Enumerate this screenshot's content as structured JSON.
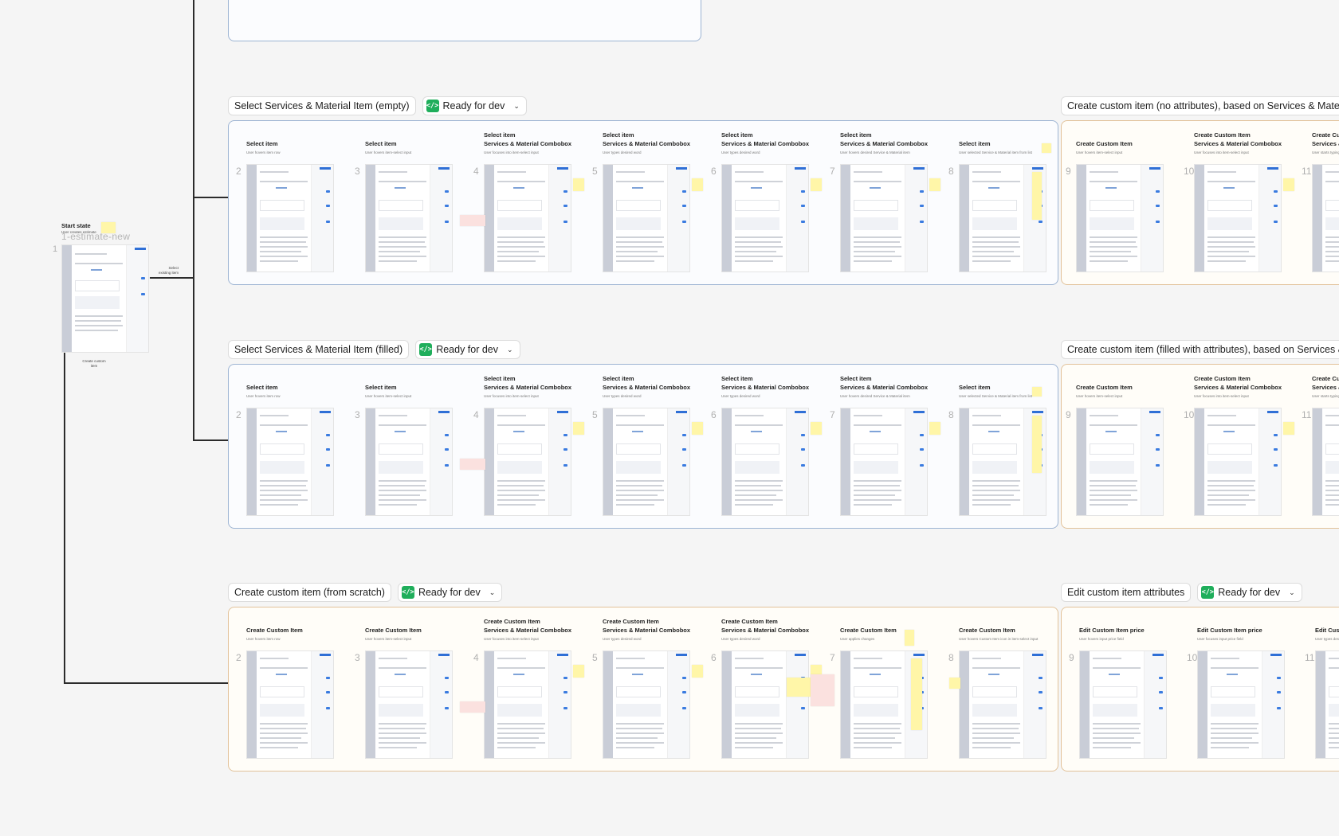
{
  "start_state": {
    "title": "Start state",
    "subtitle": "User creates estimate",
    "page_name": "1-estimate-new",
    "number": "1",
    "edge_select_label": "Select existing item",
    "edge_create_label": "Create custom item"
  },
  "status_label": "Ready for dev",
  "status_icon": "</>",
  "status_color": "#1fae5b",
  "sections": [
    {
      "title": "Select Services & Material Item (empty)",
      "status": "Ready for dev",
      "frames": [
        {
          "num": "2",
          "h1": "",
          "h2": "Select item",
          "sub": "User hovers item row"
        },
        {
          "num": "3",
          "h1": "",
          "h2": "Select item",
          "sub": "User hovers item-select input"
        },
        {
          "num": "4",
          "h1": "Select item",
          "h2": "Services & Material Combobox",
          "sub": "User focuses into item-select input"
        },
        {
          "num": "5",
          "h1": "Select item",
          "h2": "Services & Material Combobox",
          "sub": "User types desired word"
        },
        {
          "num": "6",
          "h1": "Select item",
          "h2": "Services & Material Combobox",
          "sub": "User types desired word"
        },
        {
          "num": "7",
          "h1": "Select item",
          "h2": "Services & Material Combobox",
          "sub": "User hovers desired Service & Material item"
        },
        {
          "num": "8",
          "h1": "",
          "h2": "Select item",
          "sub": "User selected Service & Material item from list"
        }
      ]
    },
    {
      "title": "Select Services & Material Item (filled)",
      "status": "Ready for dev",
      "frames": [
        {
          "num": "2",
          "h1": "",
          "h2": "Select item",
          "sub": "User hovers item row"
        },
        {
          "num": "3",
          "h1": "",
          "h2": "Select item",
          "sub": "User hovers item-select input"
        },
        {
          "num": "4",
          "h1": "Select item",
          "h2": "Services & Material Combobox",
          "sub": "User focuses into item-select input"
        },
        {
          "num": "5",
          "h1": "Select item",
          "h2": "Services & Material Combobox",
          "sub": "User types desired word"
        },
        {
          "num": "6",
          "h1": "Select item",
          "h2": "Services & Material Combobox",
          "sub": "User types desired word"
        },
        {
          "num": "7",
          "h1": "Select item",
          "h2": "Services & Material Combobox",
          "sub": "User hovers desired Service & Material item"
        },
        {
          "num": "8",
          "h1": "",
          "h2": "Select item",
          "sub": "User selected Service & Material item from list"
        }
      ]
    },
    {
      "title": "Create custom item (from scratch)",
      "status": "Ready for dev",
      "frames": [
        {
          "num": "2",
          "h1": "",
          "h2": "Create Custom Item",
          "sub": "User hovers item row"
        },
        {
          "num": "3",
          "h1": "",
          "h2": "Create Custom Item",
          "sub": "User hovers item-select input"
        },
        {
          "num": "4",
          "h1": "Create Custom Item",
          "h2": "Services & Material Combobox",
          "sub": "User focuses into item-select input"
        },
        {
          "num": "5",
          "h1": "Create Custom Item",
          "h2": "Services & Material Combobox",
          "sub": "User types desired word"
        },
        {
          "num": "6",
          "h1": "Create Custom Item",
          "h2": "Services & Material Combobox",
          "sub": "User types desired word"
        },
        {
          "num": "7",
          "h1": "",
          "h2": "Create Custom Item",
          "sub": "User applies changes"
        },
        {
          "num": "8",
          "h1": "",
          "h2": "Create Custom Item",
          "sub": "User hovers Custom Item icon in item-select input"
        }
      ]
    },
    {
      "title": "Create custom item (no attributes), based on Services & Material",
      "frames": [
        {
          "num": "9",
          "h1": "",
          "h2": "Create Custom Item",
          "sub": "User hovers item-select input"
        },
        {
          "num": "10",
          "h1": "Create Custom Item",
          "h2": "Services & Material Combobox",
          "sub": "User focuses into item-select input"
        },
        {
          "num": "11",
          "h1": "Create Custom Item",
          "h2": "Services & Material Combobox",
          "sub": "User starts typing"
        }
      ]
    },
    {
      "title": "Create custom item (filled with attributes), based on Services & M",
      "frames": [
        {
          "num": "9",
          "h1": "",
          "h2": "Create Custom Item",
          "sub": "User hovers item-select input"
        },
        {
          "num": "10",
          "h1": "Create Custom Item",
          "h2": "Services & Material Combobox",
          "sub": "User focuses into item-select input"
        },
        {
          "num": "11",
          "h1": "Create Custom Item",
          "h2": "Services & Material Combobox",
          "sub": "User starts typing"
        }
      ]
    },
    {
      "title": "Edit custom item attributes",
      "status": "Ready for dev",
      "frames": [
        {
          "num": "9",
          "h1": "",
          "h2": "Edit Custom Item price",
          "sub": "User hovers input price field"
        },
        {
          "num": "10",
          "h1": "",
          "h2": "Edit Custom Item price",
          "sub": "User focuses input price field"
        },
        {
          "num": "11",
          "h1": "",
          "h2": "Edit Custom Item price",
          "sub": "User types desired"
        }
      ]
    }
  ]
}
